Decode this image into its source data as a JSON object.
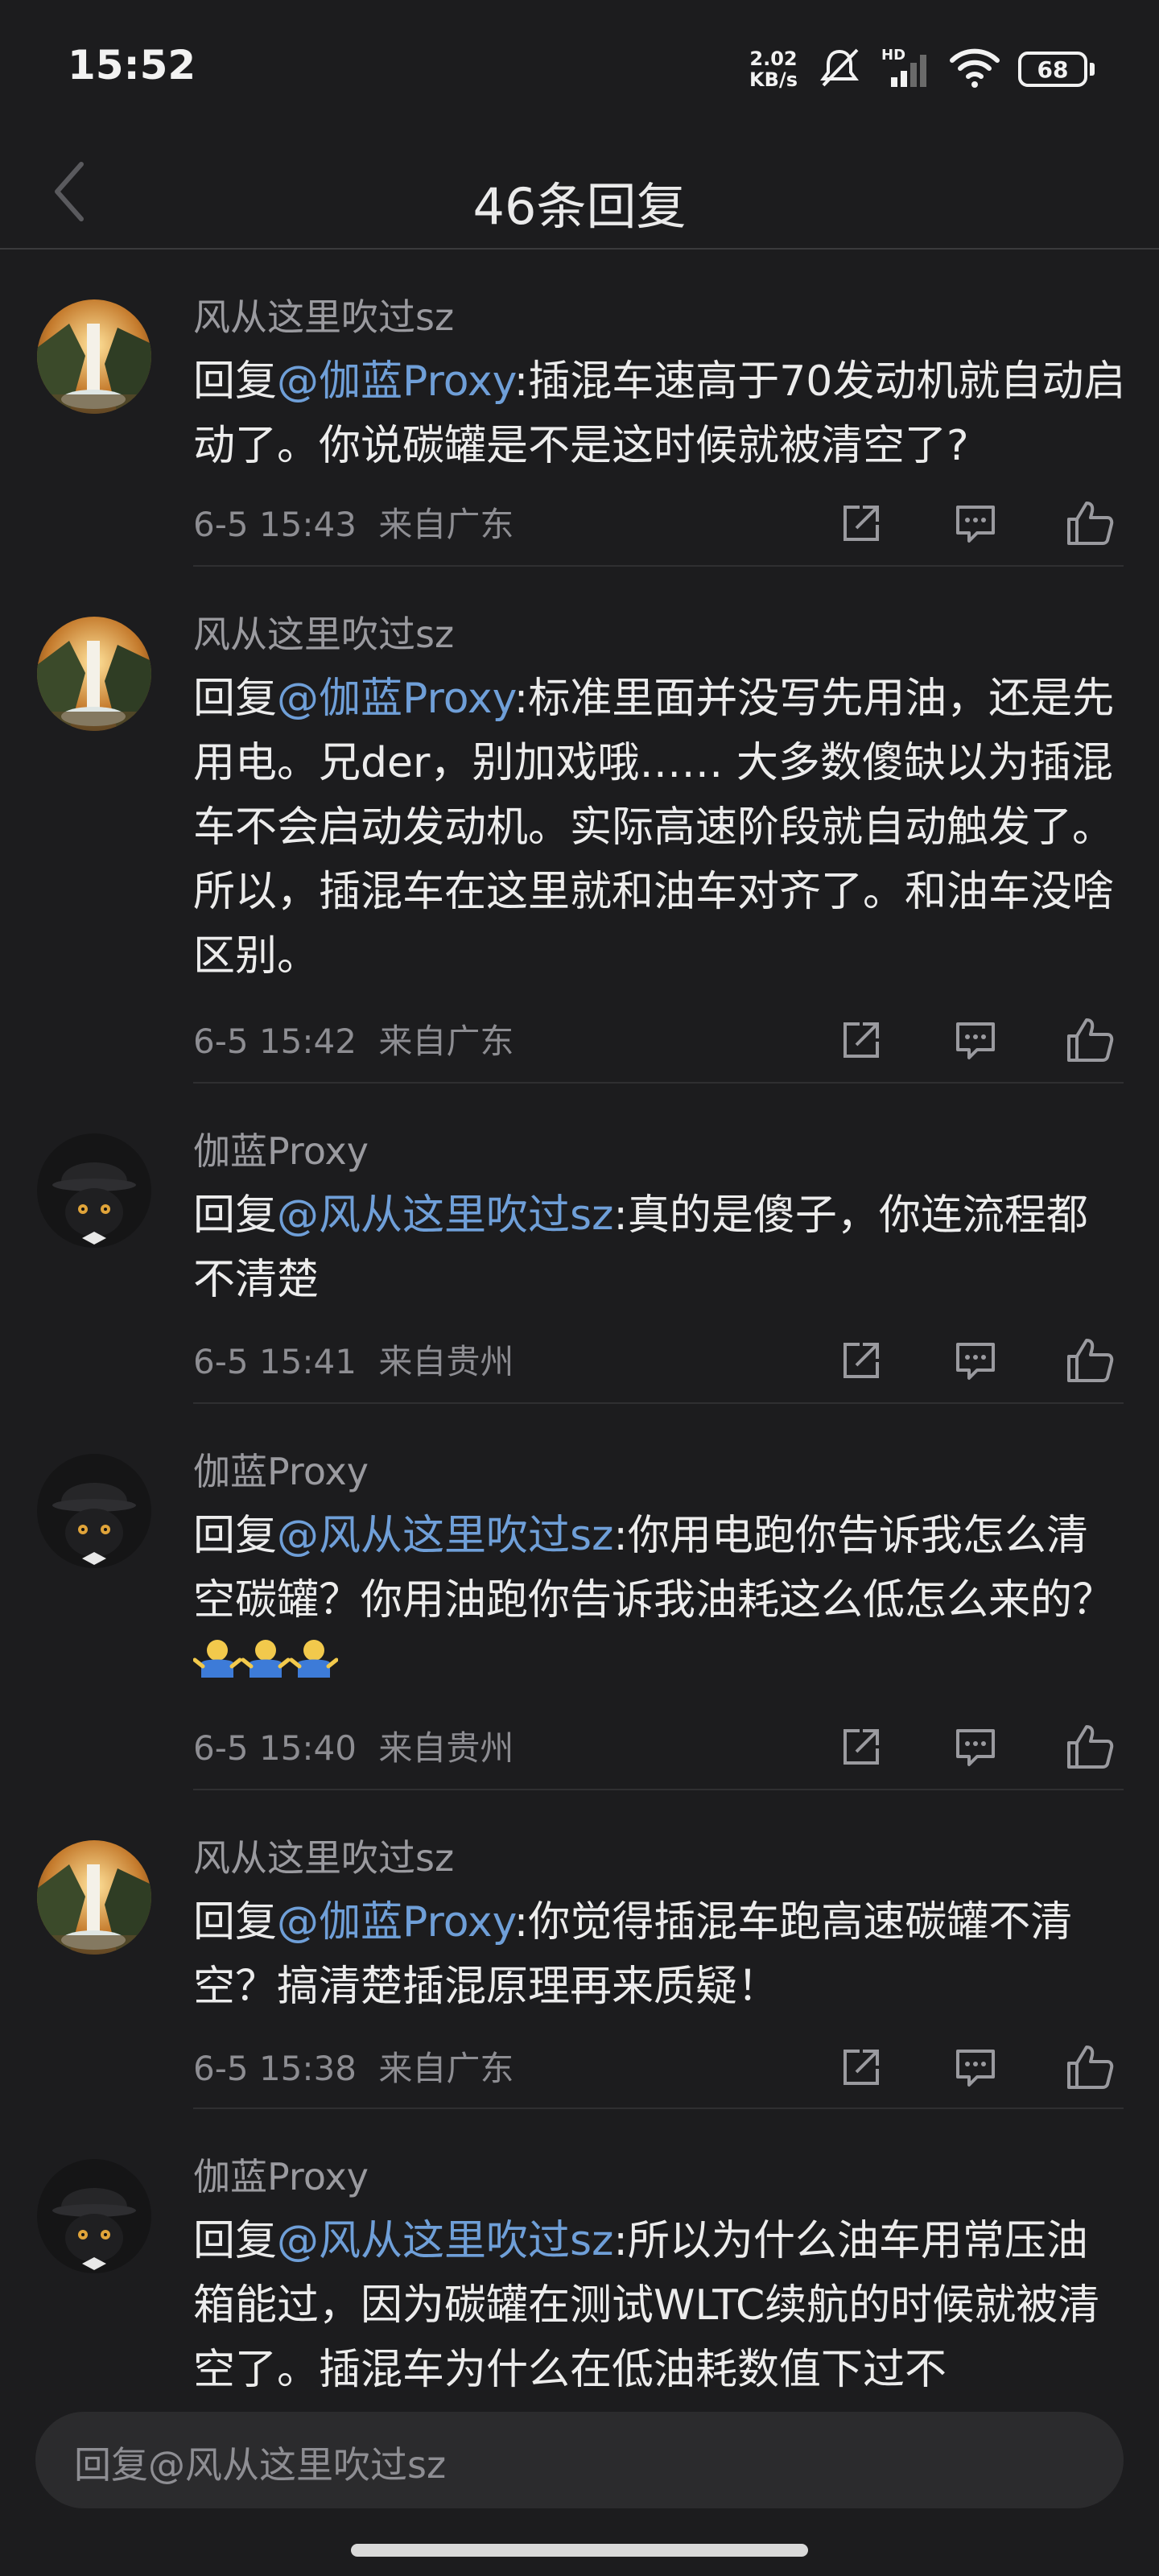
{
  "status_bar": {
    "time": "15:52",
    "net_speed_value": "2.02",
    "net_speed_unit": "KB/s",
    "network_label": "HD",
    "battery": "68"
  },
  "header": {
    "title": "46条回复",
    "back_icon": "chevron-left-icon"
  },
  "comments": [
    {
      "username": "风从这里吹过sz",
      "avatar": "waterfall-avatar",
      "prefix": "回复",
      "mention": "@伽蓝Proxy",
      "text": ":插混车速高于70发动机就自动启动了。你说碳罐是不是这时候就被清空了?",
      "time": "6-5 15:43",
      "location": "来自广东"
    },
    {
      "username": "风从这里吹过sz",
      "avatar": "waterfall-avatar",
      "prefix": "回复",
      "mention": "@伽蓝Proxy",
      "text": ":标准里面并没写先用油，还是先用电。兄der，别加戏哦…… 大多数傻缺以为插混车不会启动发动机。实际高速阶段就自动触发了。所以，插混车在这里就和油车对齐了。和油车没啥区别。",
      "time": "6-5 15:42",
      "location": "来自广东"
    },
    {
      "username": "伽蓝Proxy",
      "avatar": "cat-avatar",
      "prefix": "回复",
      "mention": "@风从这里吹过sz",
      "text": ":真的是傻子，你连流程都不清楚",
      "time": "6-5 15:41",
      "location": "来自贵州"
    },
    {
      "username": "伽蓝Proxy",
      "avatar": "cat-avatar",
      "prefix": "回复",
      "mention": "@风从这里吹过sz",
      "text": ":你用电跑你告诉我怎么清空碳罐？你用油跑你告诉我油耗这么低怎么来的？",
      "emoji": "shrug-emoji",
      "time": "6-5 15:40",
      "location": "来自贵州"
    },
    {
      "username": "风从这里吹过sz",
      "avatar": "waterfall-avatar",
      "prefix": "回复",
      "mention": "@伽蓝Proxy",
      "text": ":你觉得插混车跑高速碳罐不清空？搞清楚插混原理再来质疑！",
      "time": "6-5 15:38",
      "location": "来自广东"
    },
    {
      "username": "伽蓝Proxy",
      "avatar": "cat-avatar",
      "prefix": "回复",
      "mention": "@风从这里吹过sz",
      "text": ":所以为什么油车用常压油箱能过，因为碳罐在测试WLTC续航的时候就被清空了。插混车为什么在低油耗数值下过不",
      "time": "",
      "location": ""
    }
  ],
  "actions": {
    "share_icon": "share-icon",
    "comment_icon": "comment-icon",
    "like_icon": "thumbs-up-icon"
  },
  "reply_bar": {
    "placeholder": "回复@风从这里吹过sz"
  },
  "colors": {
    "background": "#1c1c1e",
    "mention": "#6f9fd8",
    "meta": "#8d8d92",
    "text": "#ececec"
  }
}
